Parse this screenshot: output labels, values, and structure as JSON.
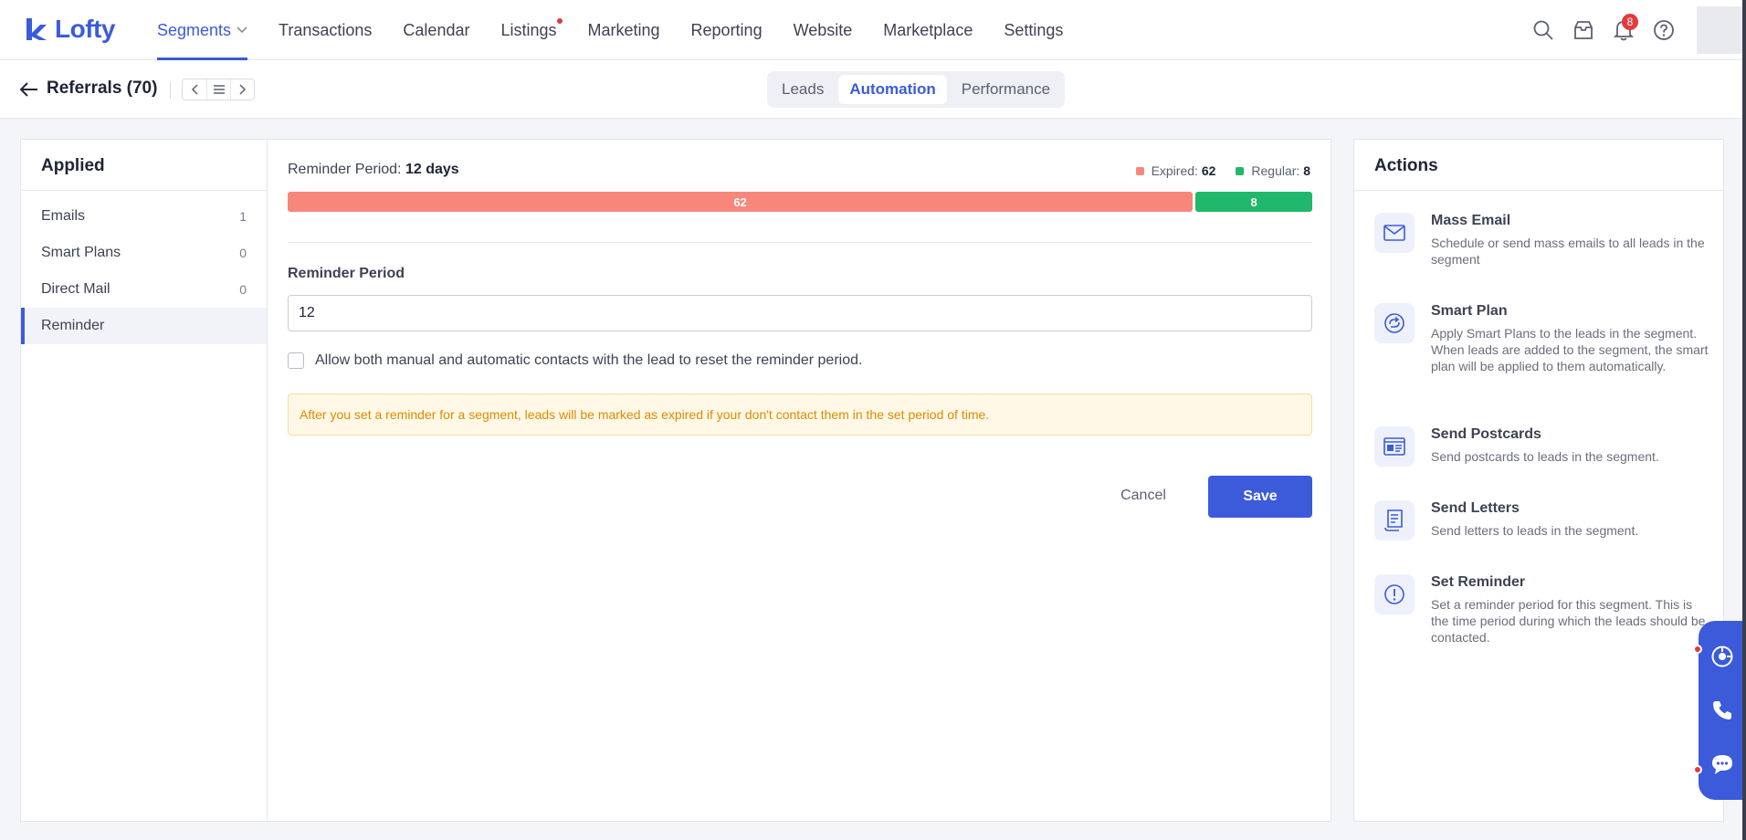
{
  "app": {
    "logo_text": "Lofty",
    "brand_color": "#3b5bdb"
  },
  "nav": {
    "items": [
      {
        "label": "Segments",
        "active": true,
        "has_caret": true
      },
      {
        "label": "Transactions"
      },
      {
        "label": "Calendar"
      },
      {
        "label": "Listings",
        "has_dot": true
      },
      {
        "label": "Marketing"
      },
      {
        "label": "Reporting"
      },
      {
        "label": "Website"
      },
      {
        "label": "Marketplace"
      },
      {
        "label": "Settings"
      }
    ],
    "notification_count": "8",
    "icons": [
      "search-icon",
      "inbox-icon",
      "bell-icon",
      "help-icon"
    ]
  },
  "subheader": {
    "title": "Referrals (70)",
    "tabs": [
      {
        "label": "Leads"
      },
      {
        "label": "Automation",
        "active": true
      },
      {
        "label": "Performance"
      }
    ]
  },
  "left_panel": {
    "title": "Applied",
    "items": [
      {
        "label": "Emails",
        "count": "1"
      },
      {
        "label": "Smart Plans",
        "count": "0"
      },
      {
        "label": "Direct Mail",
        "count": "0"
      },
      {
        "label": "Reminder",
        "count": "",
        "active": true
      }
    ]
  },
  "reminder": {
    "period_label": "Reminder Period:",
    "period_value": "12 days",
    "legend": {
      "expired_label": "Expired:",
      "expired_value": "62",
      "regular_label": "Regular:",
      "regular_value": "8"
    },
    "bar": {
      "expired": 62,
      "regular": 8,
      "expired_color": "#f7877b",
      "regular_color": "#20b86a"
    },
    "field_label": "Reminder Period",
    "field_value": "12",
    "checkbox_label": "Allow both manual and automatic contacts with the lead to reset the reminder period.",
    "notice": "After you set a reminder for a segment, leads will be marked as expired if your don't contact them in the set period of time.",
    "cancel_label": "Cancel",
    "save_label": "Save"
  },
  "actions": {
    "title": "Actions",
    "items": [
      {
        "icon": "mail-icon",
        "title": "Mass Email",
        "desc": "Schedule or send mass emails to all leads in the segment"
      },
      {
        "icon": "smart-plan-icon",
        "title": "Smart Plan",
        "desc": "Apply Smart Plans to the leads in the segment. When leads are added to the segment, the smart plan will be applied to them automatically."
      },
      {
        "icon": "postcard-icon",
        "title": "Send Postcards",
        "desc": "Send postcards to leads in the segment."
      },
      {
        "icon": "letter-icon",
        "title": "Send Letters",
        "desc": "Send letters to leads in the segment."
      },
      {
        "icon": "reminder-icon",
        "title": "Set Reminder",
        "desc": "Set a reminder period for this segment. This is the time period during which the leads should be contacted."
      }
    ]
  }
}
